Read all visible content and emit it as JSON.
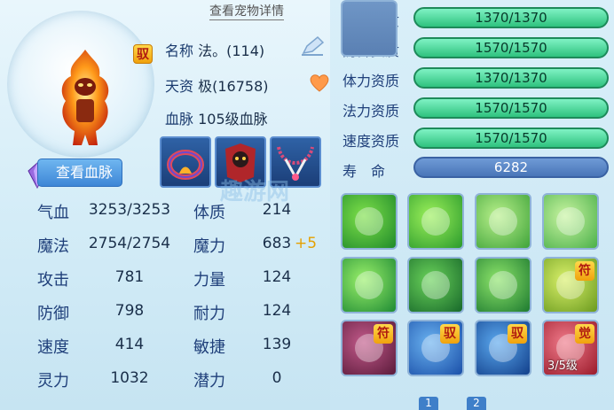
{
  "header": {
    "detail_link": "查看宠物详情"
  },
  "pet": {
    "name_label": "名称",
    "name_value": "法。(114)",
    "talent_label": "天资",
    "talent_value": "极(16758)",
    "bloodline_label": "血脉",
    "bloodline_value": "105级血脉",
    "tame_badge": "驭",
    "view_bloodline": "查看血脉"
  },
  "stats_left": [
    {
      "label": "气血",
      "value": "3253/3253"
    },
    {
      "label": "魔法",
      "value": "2754/2754"
    },
    {
      "label": "攻击",
      "value": "781"
    },
    {
      "label": "防御",
      "value": "798"
    },
    {
      "label": "速度",
      "value": "414"
    },
    {
      "label": "灵力",
      "value": "1032"
    }
  ],
  "stats_right": [
    {
      "label": "体质",
      "value": "214",
      "bonus": ""
    },
    {
      "label": "魔力",
      "value": "683",
      "bonus": "+5"
    },
    {
      "label": "力量",
      "value": "124",
      "bonus": ""
    },
    {
      "label": "耐力",
      "value": "124",
      "bonus": ""
    },
    {
      "label": "敏捷",
      "value": "139",
      "bonus": ""
    },
    {
      "label": "潜力",
      "value": "0",
      "bonus": ""
    }
  ],
  "aptitudes": [
    {
      "label": "攻击资质",
      "value": "1370/1370",
      "fill": 1.0
    },
    {
      "label": "防御资质",
      "value": "1570/1570",
      "fill": 1.0
    },
    {
      "label": "体力资质",
      "value": "1370/1370",
      "fill": 1.0
    },
    {
      "label": "法力资质",
      "value": "1570/1570",
      "fill": 1.0
    },
    {
      "label": "速度资质",
      "value": "1570/1570",
      "fill": 1.0
    }
  ],
  "life": {
    "label": "寿　命",
    "value": "6282"
  },
  "skills": [
    {
      "icon": "wind-skill-icon",
      "color1": "#7ee04a",
      "color2": "#1f8a2a",
      "badge": "",
      "level": ""
    },
    {
      "icon": "dancer-skill-icon",
      "color1": "#9cf05a",
      "color2": "#2a9a2c",
      "badge": "",
      "level": ""
    },
    {
      "icon": "hand-point-skill-icon",
      "color1": "#b8f08a",
      "color2": "#3fa33a",
      "badge": "",
      "level": ""
    },
    {
      "icon": "palm-skill-icon",
      "color1": "#c8f4a0",
      "color2": "#4ab04a",
      "badge": "",
      "level": ""
    },
    {
      "icon": "green-burst-skill-icon",
      "color1": "#9af06a",
      "color2": "#1e8a34",
      "badge": "",
      "level": ""
    },
    {
      "icon": "cat-skill-icon",
      "color1": "#6ad25a",
      "color2": "#17682a",
      "badge": "",
      "level": ""
    },
    {
      "icon": "runner-skill-icon",
      "color1": "#8de46a",
      "color2": "#1d7a30",
      "badge": "",
      "level": ""
    },
    {
      "icon": "shield-talisman-skill-icon",
      "color1": "#d9f06a",
      "color2": "#6a9a1e",
      "badge": "符",
      "level": ""
    },
    {
      "icon": "beast-talisman-skill-icon",
      "color1": "#c25a8a",
      "color2": "#5a1a3a",
      "badge": "符",
      "level": ""
    },
    {
      "icon": "claw-skill-icon",
      "color1": "#6ab2f0",
      "color2": "#1a4fa8",
      "badge": "驭",
      "level": ""
    },
    {
      "icon": "ice-shard-skill-icon",
      "color1": "#5aa8ee",
      "color2": "#123f8a",
      "badge": "驭",
      "level": ""
    },
    {
      "icon": "fist-awaken-skill-icon",
      "color1": "#f07a8a",
      "color2": "#9a1a2a",
      "badge": "觉",
      "level": "3/5级"
    },
    {
      "icon": "empty-slot",
      "color1": "",
      "color2": "",
      "badge": "",
      "level": ""
    }
  ],
  "tabs": [
    "1",
    "2"
  ],
  "watermark": "趣游网"
}
